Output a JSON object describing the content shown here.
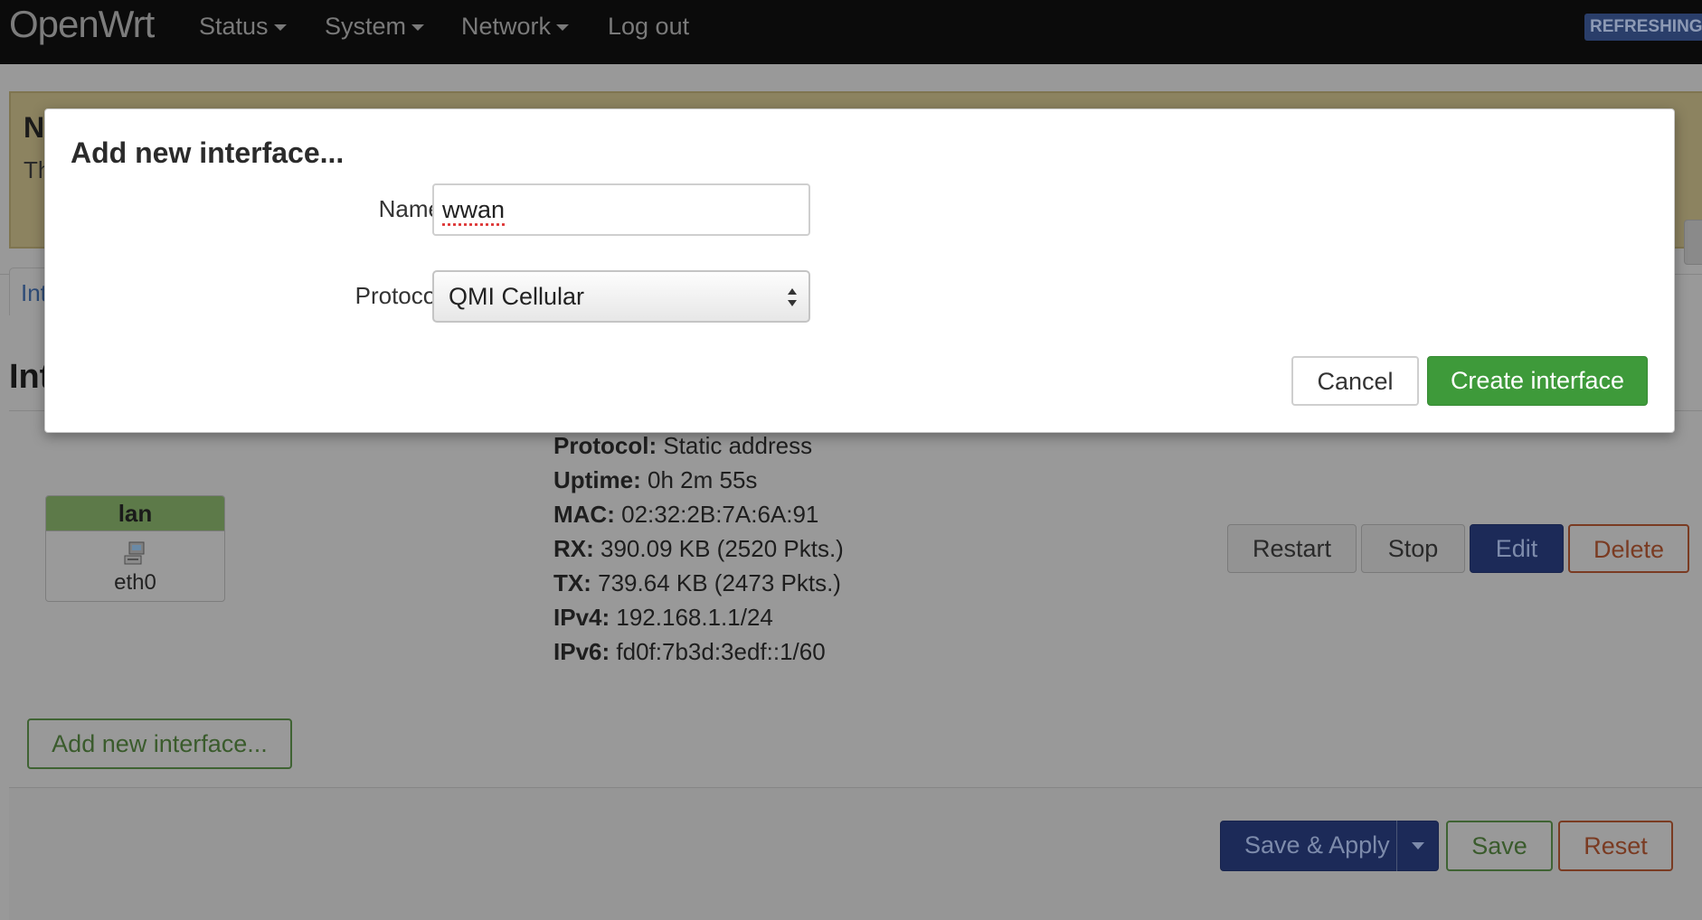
{
  "navbar": {
    "brand": "OpenWrt",
    "menu": [
      {
        "label": "Status",
        "has_caret": true
      },
      {
        "label": "System",
        "has_caret": true
      },
      {
        "label": "Network",
        "has_caret": true
      },
      {
        "label": "Log out",
        "has_caret": false
      }
    ],
    "refresh_badge": "REFRESHING"
  },
  "page": {
    "alert": {
      "title": "N",
      "text": "Th"
    },
    "tab_label": "Int",
    "section_title": "Int",
    "interface": {
      "name": "lan",
      "device": "eth0",
      "details": [
        {
          "key": "Protocol:",
          "value": "Static address"
        },
        {
          "key": "Uptime:",
          "value": "0h 2m 55s"
        },
        {
          "key": "MAC:",
          "value": "02:32:2B:7A:6A:91"
        },
        {
          "key": "RX:",
          "value": "390.09 KB (2520 Pkts.)"
        },
        {
          "key": "TX:",
          "value": "739.64 KB (2473 Pkts.)"
        },
        {
          "key": "IPv4:",
          "value": "192.168.1.1/24"
        },
        {
          "key": "IPv6:",
          "value": "fd0f:7b3d:3edf::1/60"
        }
      ],
      "actions": {
        "restart": "Restart",
        "stop": "Stop",
        "edit": "Edit",
        "delete": "Delete"
      }
    },
    "add_interface_label": "Add new interface...",
    "footer": {
      "save_apply": "Save & Apply",
      "save": "Save",
      "reset": "Reset"
    }
  },
  "modal": {
    "title": "Add new interface...",
    "name_label": "Name",
    "name_value": "wwan",
    "protocol_label": "Protocol",
    "protocol_value": "QMI Cellular",
    "cancel_label": "Cancel",
    "create_label": "Create interface"
  },
  "colors": {
    "create_button": "#3e9a3a",
    "navbar_bg": "#0b0b0b",
    "edit_button": "#1c2a58",
    "interface_header": "#5d7a49"
  }
}
